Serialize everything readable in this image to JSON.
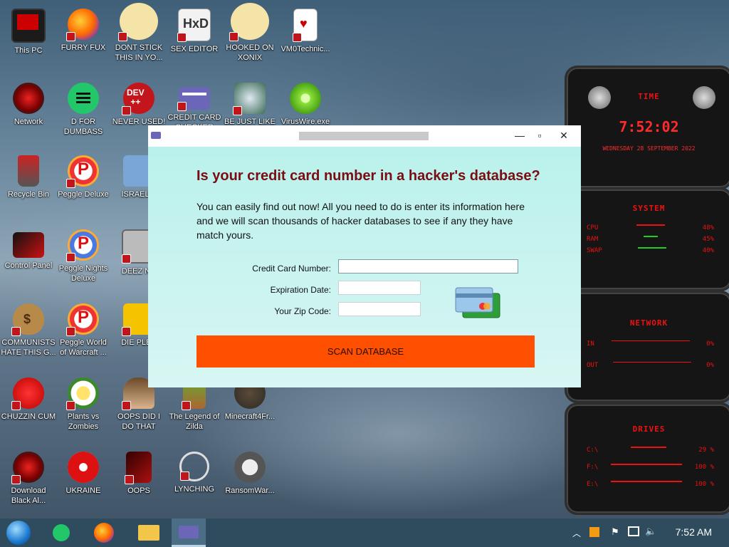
{
  "desktop": {
    "icons": [
      {
        "label": "This PC"
      },
      {
        "label": "FURRY FUX"
      },
      {
        "label": "DONT STICK THIS IN YO..."
      },
      {
        "label": "SEX EDITOR"
      },
      {
        "label": "HOOKED ON XONIX"
      },
      {
        "label": "VM0Technic..."
      },
      {
        "label": "Network"
      },
      {
        "label": "D FOR DUMBASS"
      },
      {
        "label": "NEVER USED!"
      },
      {
        "label": "CREDIT CARD CHECKER"
      },
      {
        "label": "BE JUST LIKE THE DUDE!"
      },
      {
        "label": "VirusWire.exe"
      },
      {
        "label": "Recycle Bin"
      },
      {
        "label": "Peggle Deluxe"
      },
      {
        "label": "ISRAEL S"
      },
      {
        "label": "Control Panel"
      },
      {
        "label": "Peggle Nights Deluxe"
      },
      {
        "label": "DEEZ NU"
      },
      {
        "label": "COMMUNISTS HATE THIS G..."
      },
      {
        "label": "Peggle World of Warcraft ..."
      },
      {
        "label": "DIE PLEA"
      },
      {
        "label": "CHUZZIN CUM"
      },
      {
        "label": "Plants vs Zombies"
      },
      {
        "label": "OOPS DID I DO THAT"
      },
      {
        "label": "The Legend of Zilda"
      },
      {
        "label": "Minecraft4Fr..."
      },
      {
        "label": "Download Black Al..."
      },
      {
        "label": "UKRAINE"
      },
      {
        "label": "OOPS"
      },
      {
        "label": "LYNCHING"
      },
      {
        "label": "RansomWar..."
      }
    ],
    "icon_badges": {
      "dev": "DEV\n++",
      "peggle": "P"
    }
  },
  "widget": {
    "time_title": "TIME",
    "time": "7:52:02",
    "date": "WEDNESDAY 28 SEPTEMBER 2022",
    "system_title": "SYSTEM",
    "system_rows": [
      {
        "name": "CPU",
        "value": "48%"
      },
      {
        "name": "RAM",
        "value": "45%"
      },
      {
        "name": "SWAP",
        "value": "40%"
      }
    ],
    "network_title": "NETWORK",
    "network_rows": [
      {
        "name": "IN",
        "value": "0%"
      },
      {
        "name": "OUT",
        "value": "0%"
      }
    ],
    "drives_title": "DRIVES",
    "drive_rows": [
      {
        "name": "C:\\",
        "value": "29 %"
      },
      {
        "name": "F:\\",
        "value": "100 %"
      },
      {
        "name": "E:\\",
        "value": "100 %"
      }
    ]
  },
  "dialog": {
    "minimize": "—",
    "maximize": "▫",
    "close": "✕",
    "heading": "Is your credit card number in a hacker's database?",
    "description": "You can easily find out now! All you need to do is enter its information here and we will scan thousands of hacker databases to see if any they have match yours.",
    "card_number_label": "Credit Card Number:",
    "expiration_label": "Expiration Date:",
    "zip_label": "Your Zip Code:",
    "card_number_value": "",
    "expiration_value": "",
    "zip_value": "",
    "scan_button": "SCAN DATABASE"
  },
  "taskbar": {
    "clock": "7:52 AM"
  }
}
